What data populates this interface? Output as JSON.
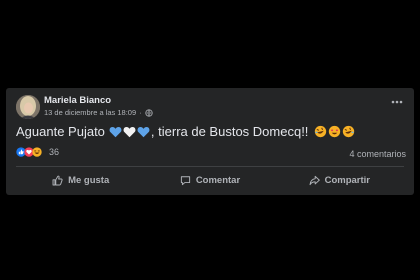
{
  "post": {
    "author": "Mariela Bianco",
    "timestamp": "13 de diciembre a las 18:09",
    "separator": "·",
    "text": "Aguante Pujato",
    "text_after_hearts": ", tierra de Bustos Domecq!!",
    "reactions_count": "36",
    "comments_label": "4 comentarios"
  },
  "actions": {
    "like_label": "Me gusta",
    "comment_label": "Comentar",
    "share_label": "Compartir"
  },
  "icons": {
    "privacy": "globe-icon",
    "more": "more-options-icon",
    "like": "thumbs-up-icon",
    "comment": "comment-bubble-icon",
    "share": "share-arrow-icon"
  },
  "colors": {
    "card": "#242526",
    "text": "#e4e6eb",
    "muted": "#b0b3b8",
    "like_blue": "#1877f2",
    "love_red": "#f33e58",
    "haha_yellow": "#f7b125"
  }
}
